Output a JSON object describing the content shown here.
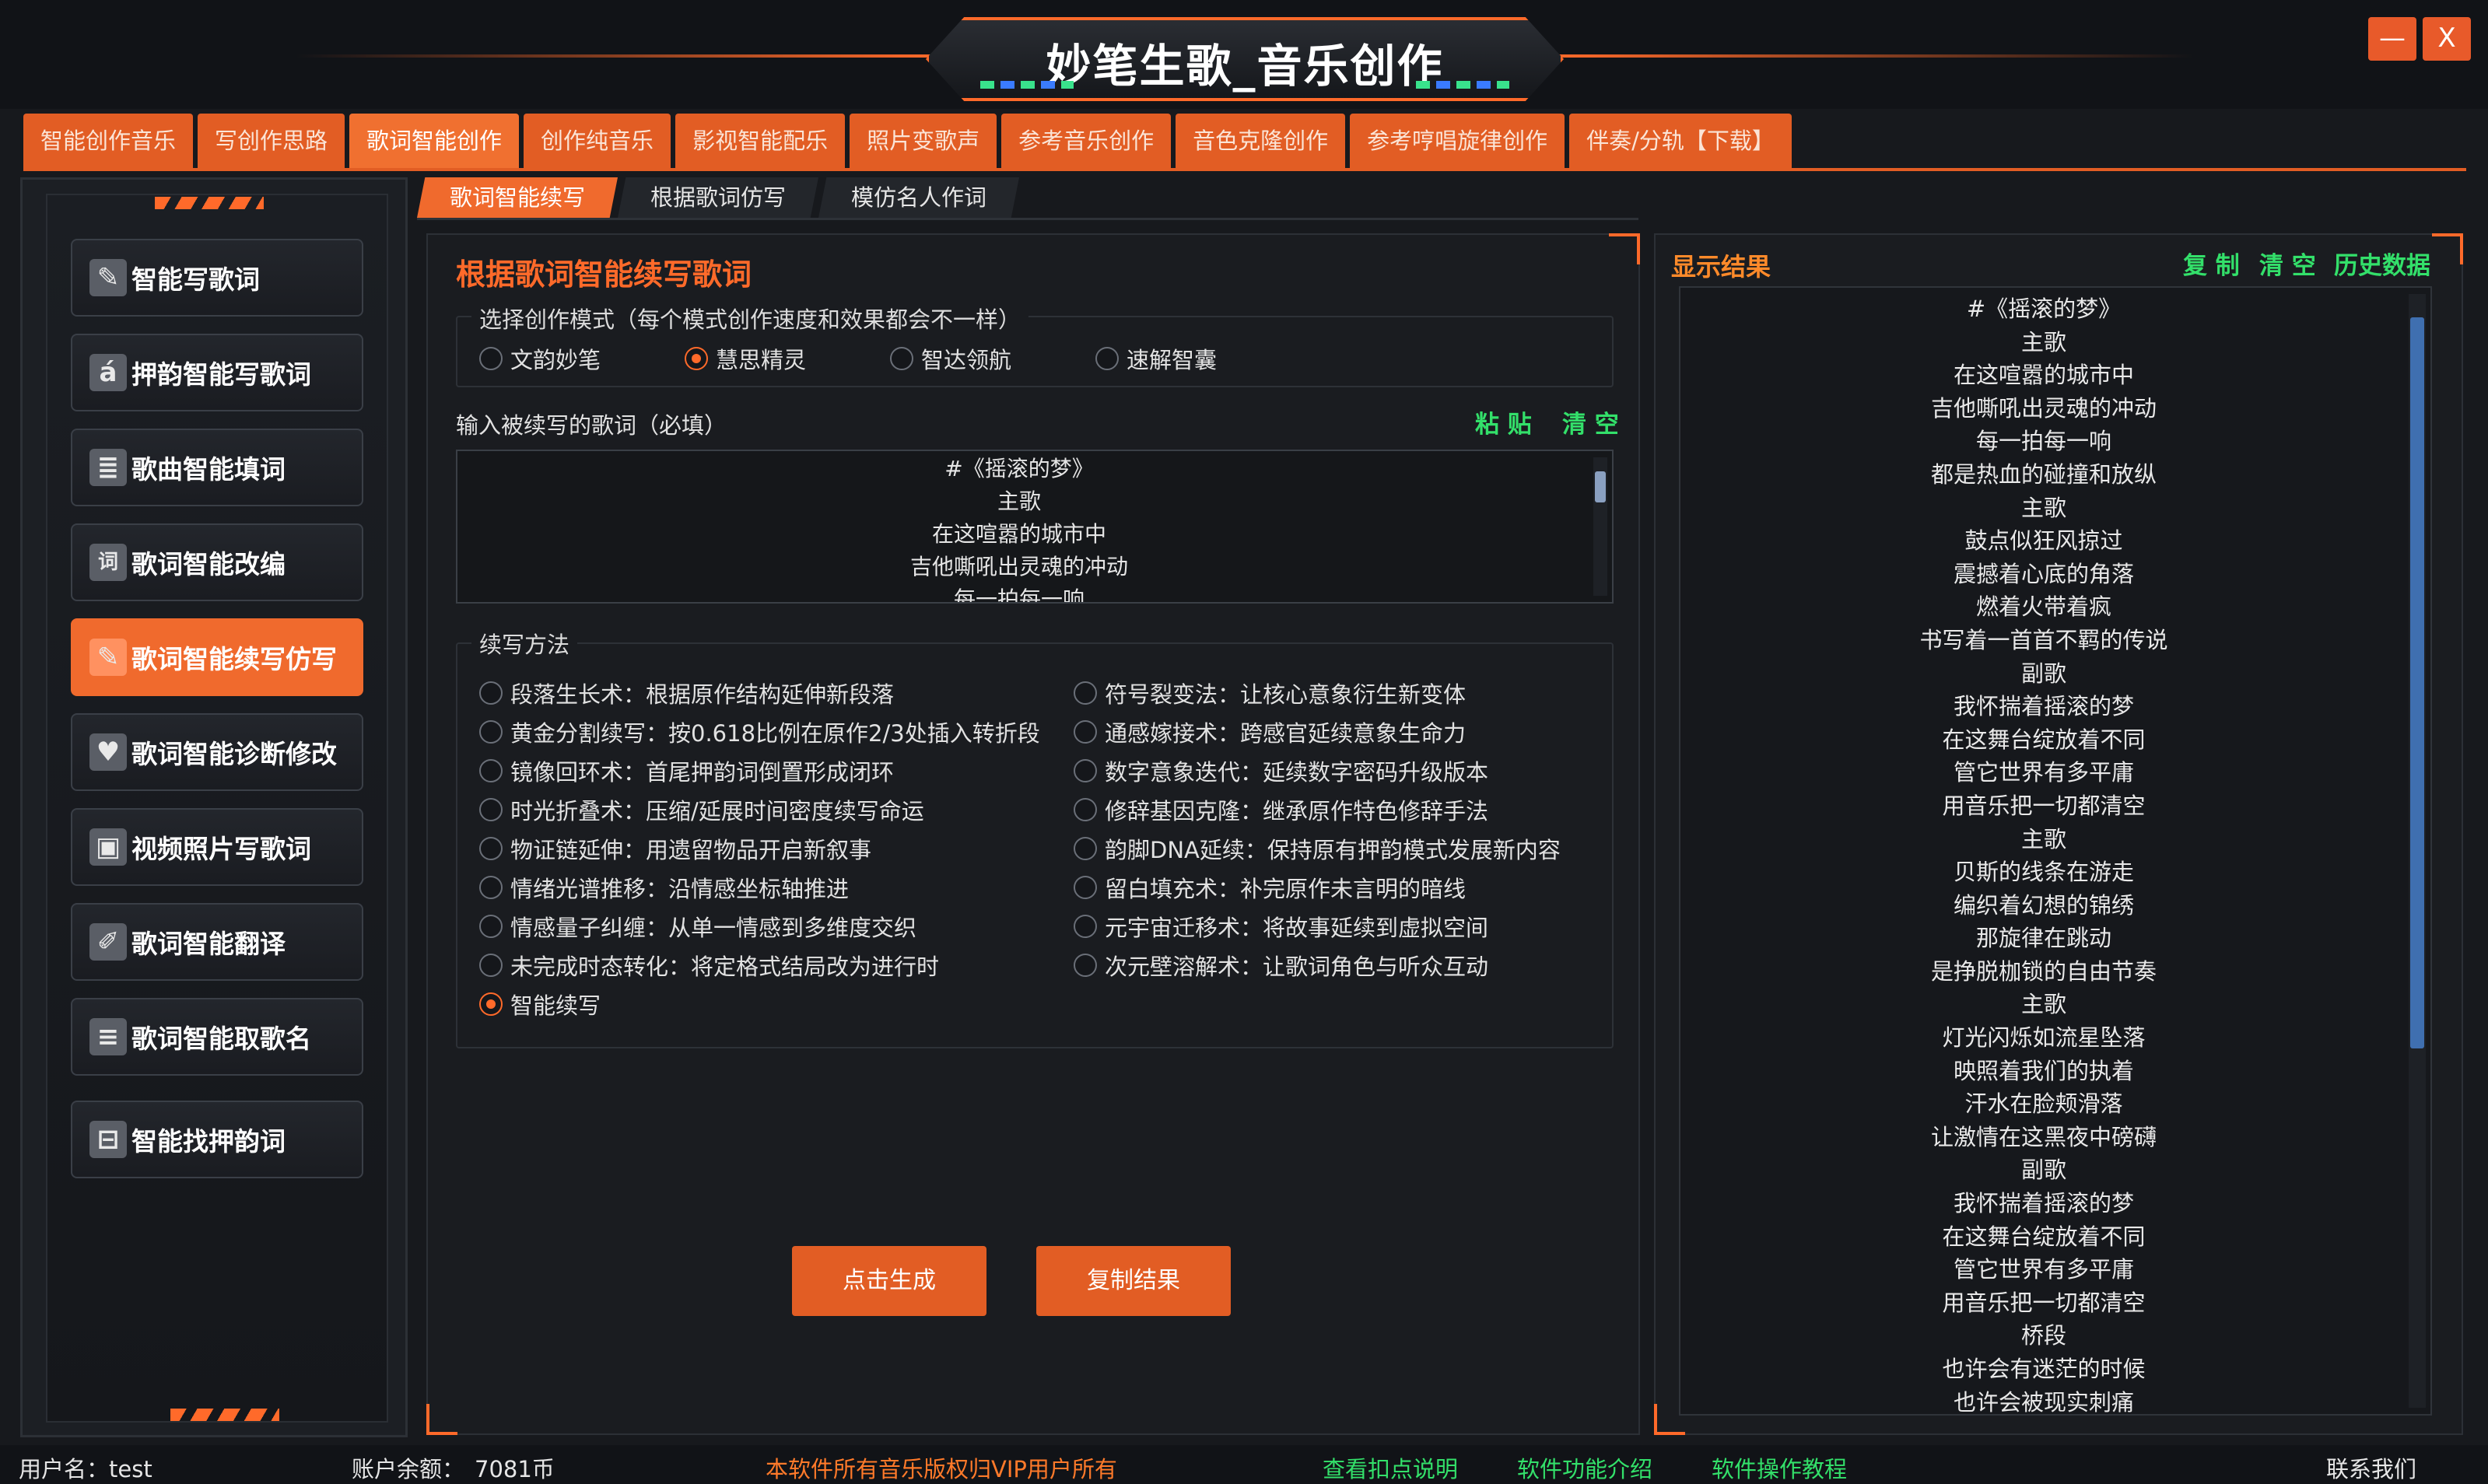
{
  "app": {
    "title": "妙笔生歌_音乐创作",
    "minimize_label": "—",
    "close_label": "X"
  },
  "main_tabs": [
    {
      "label": "智能创作音乐"
    },
    {
      "label": "写创作思路"
    },
    {
      "label": "歌词智能创作"
    },
    {
      "label": "创作纯音乐"
    },
    {
      "label": "影视智能配乐"
    },
    {
      "label": "照片变歌声"
    },
    {
      "label": "参考音乐创作"
    },
    {
      "label": "音色克隆创作"
    },
    {
      "label": "参考哼唱旋律创作"
    },
    {
      "label": "伴奏/分轨【下载】"
    }
  ],
  "sidebar": {
    "items": [
      {
        "label": "智能写歌词",
        "icon": "pen-icon",
        "glyph": "✎"
      },
      {
        "label": "押韵智能写歌词",
        "icon": "rhyme-icon",
        "glyph": "á"
      },
      {
        "label": "歌曲智能填词",
        "icon": "fill-icon",
        "glyph": "≣"
      },
      {
        "label": "歌词智能改编",
        "icon": "word-icon",
        "glyph": "词"
      },
      {
        "label": "歌词智能续写仿写",
        "icon": "pen-icon",
        "glyph": "✎"
      },
      {
        "label": "歌词智能诊断修改",
        "icon": "pulse-icon",
        "glyph": "♥"
      },
      {
        "label": "视频照片写歌词",
        "icon": "photo-icon",
        "glyph": "▣"
      },
      {
        "label": "歌词智能翻译",
        "icon": "translate-icon",
        "glyph": "✐"
      },
      {
        "label": "歌词智能取歌名",
        "icon": "name-icon",
        "glyph": "≡"
      },
      {
        "label": "智能找押韵词",
        "icon": "sliders-icon",
        "glyph": "⊟"
      }
    ]
  },
  "sub_tabs": [
    {
      "label": "歌词智能续写"
    },
    {
      "label": "根据歌词仿写"
    },
    {
      "label": "模仿名人作词"
    }
  ],
  "panel": {
    "title": "根据歌词智能续写歌词",
    "mode_group_title": "选择创作模式（每个模式创作速度和效果都会不一样）",
    "modes": [
      {
        "label": "文韵妙笔",
        "selected": false
      },
      {
        "label": "慧思精灵",
        "selected": true
      },
      {
        "label": "智达领航",
        "selected": false
      },
      {
        "label": "速解智囊",
        "selected": false
      }
    ],
    "input_label": "输入被续写的歌词（必填）",
    "paste_label": "粘 贴",
    "clear_label": "清 空",
    "input_lines": [
      "#《摇滚的梦》",
      "主歌",
      "在这喧嚣的城市中",
      "吉他嘶吼出灵魂的冲动",
      "每一拍每一响"
    ],
    "method_group_title": "续写方法",
    "methods_left": [
      {
        "label": "段落生长术：根据原作结构延伸新段落",
        "selected": false
      },
      {
        "label": "黄金分割续写：按0.618比例在原作2/3处插入转折段",
        "selected": false
      },
      {
        "label": "镜像回环术：首尾押韵词倒置形成闭环",
        "selected": false
      },
      {
        "label": "时光折叠术：压缩/延展时间密度续写命运",
        "selected": false
      },
      {
        "label": "物证链延伸：用遗留物品开启新叙事",
        "selected": false
      },
      {
        "label": "情绪光谱推移：沿情感坐标轴推进",
        "selected": false
      },
      {
        "label": "情感量子纠缠：从单一情感到多维度交织",
        "selected": false
      },
      {
        "label": "未完成时态转化：将定格式结局改为进行时",
        "selected": false
      },
      {
        "label": "智能续写",
        "selected": true
      }
    ],
    "methods_right": [
      {
        "label": "符号裂变法：让核心意象衍生新变体",
        "selected": false
      },
      {
        "label": "通感嫁接术：跨感官延续意象生命力",
        "selected": false
      },
      {
        "label": "数字意象迭代：延续数字密码升级版本",
        "selected": false
      },
      {
        "label": "修辞基因克隆：继承原作特色修辞手法",
        "selected": false
      },
      {
        "label": "韵脚DNA延续：保持原有押韵模式发展新内容",
        "selected": false
      },
      {
        "label": "留白填充术：补完原作未言明的暗线",
        "selected": false
      },
      {
        "label": "元宇宙迁移术：将故事延续到虚拟空间",
        "selected": false
      },
      {
        "label": "次元壁溶解术：让歌词角色与听众互动",
        "selected": false
      }
    ],
    "generate_label": "点击生成",
    "copy_result_label": "复制结果"
  },
  "result": {
    "title": "显示结果",
    "copy_label": "复 制",
    "clear_label": "清 空",
    "history_label": "历史数据",
    "lines": [
      "#《摇滚的梦》",
      "主歌",
      "在这喧嚣的城市中",
      "吉他嘶吼出灵魂的冲动",
      "每一拍每一响",
      "都是热血的碰撞和放纵",
      "主歌",
      "鼓点似狂风掠过",
      "震撼着心底的角落",
      "燃着火带着疯",
      "书写着一首首不羁的传说",
      "副歌",
      "我怀揣着摇滚的梦",
      "在这舞台绽放着不同",
      "管它世界有多平庸",
      "用音乐把一切都清空",
      "主歌",
      "贝斯的线条在游走",
      "编织着幻想的锦绣",
      "那旋律在跳动",
      "是挣脱枷锁的自由节奏",
      "主歌",
      "灯光闪烁如流星坠落",
      "映照着我们的执着",
      "汗水在脸颊滑落",
      "让激情在这黑夜中磅礴",
      "副歌",
      "我怀揣着摇滚的梦",
      "在这舞台绽放着不同",
      "管它世界有多平庸",
      "用音乐把一切都清空",
      "桥段",
      "也许会有迷茫的时候",
      "也许会被现实刺痛"
    ]
  },
  "status": {
    "user_label": "用户名：test",
    "balance_label": "账户余额：",
    "balance_value": "7081币",
    "copyright": "本软件所有音乐版权归VIP用户所有",
    "link_deduct": "查看扣点说明",
    "link_features": "软件功能介绍",
    "link_tutorial": "软件操作教程",
    "contact": "联系我们"
  },
  "colors": {
    "accent": "#ff6a2a",
    "green": "#33e06a",
    "background": "#17191d"
  }
}
